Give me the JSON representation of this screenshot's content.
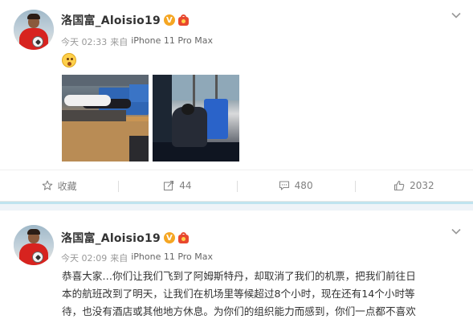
{
  "post1": {
    "author": "洛国富_Aloisio19",
    "vip_badge": "V",
    "time": "今天 02:33",
    "source_prefix": "来自",
    "device": "iPhone 11 Pro Max",
    "emoji": "surprised-face",
    "photos": [
      "photo-person-lying-on-airport-bench",
      "photo-person-sleeping-on-airport-seats"
    ],
    "actions": {
      "favorite_label": "收藏",
      "repost_count": "44",
      "comment_count": "480",
      "like_count": "2032"
    }
  },
  "post2": {
    "author": "洛国富_Aloisio19",
    "vip_badge": "V",
    "time": "今天 02:09",
    "source_prefix": "来自",
    "device": "iPhone 11 Pro Max",
    "lines": [
      "恭喜大家…你们让我们飞到了阿姆斯特丹，却取消了我们的机票，把我们前往日",
      "本的航班改到了明天，让我们在机场里等候超过8个小时，现在还有14个小时等",
      "待，也没有酒店或其他地方休息。为你们的组织能力而感到，你们一点都不喜欢"
    ]
  },
  "colors": {
    "accent_vip": "#f5a623",
    "separator": "#eef3f8",
    "muted_text": "#808080"
  }
}
